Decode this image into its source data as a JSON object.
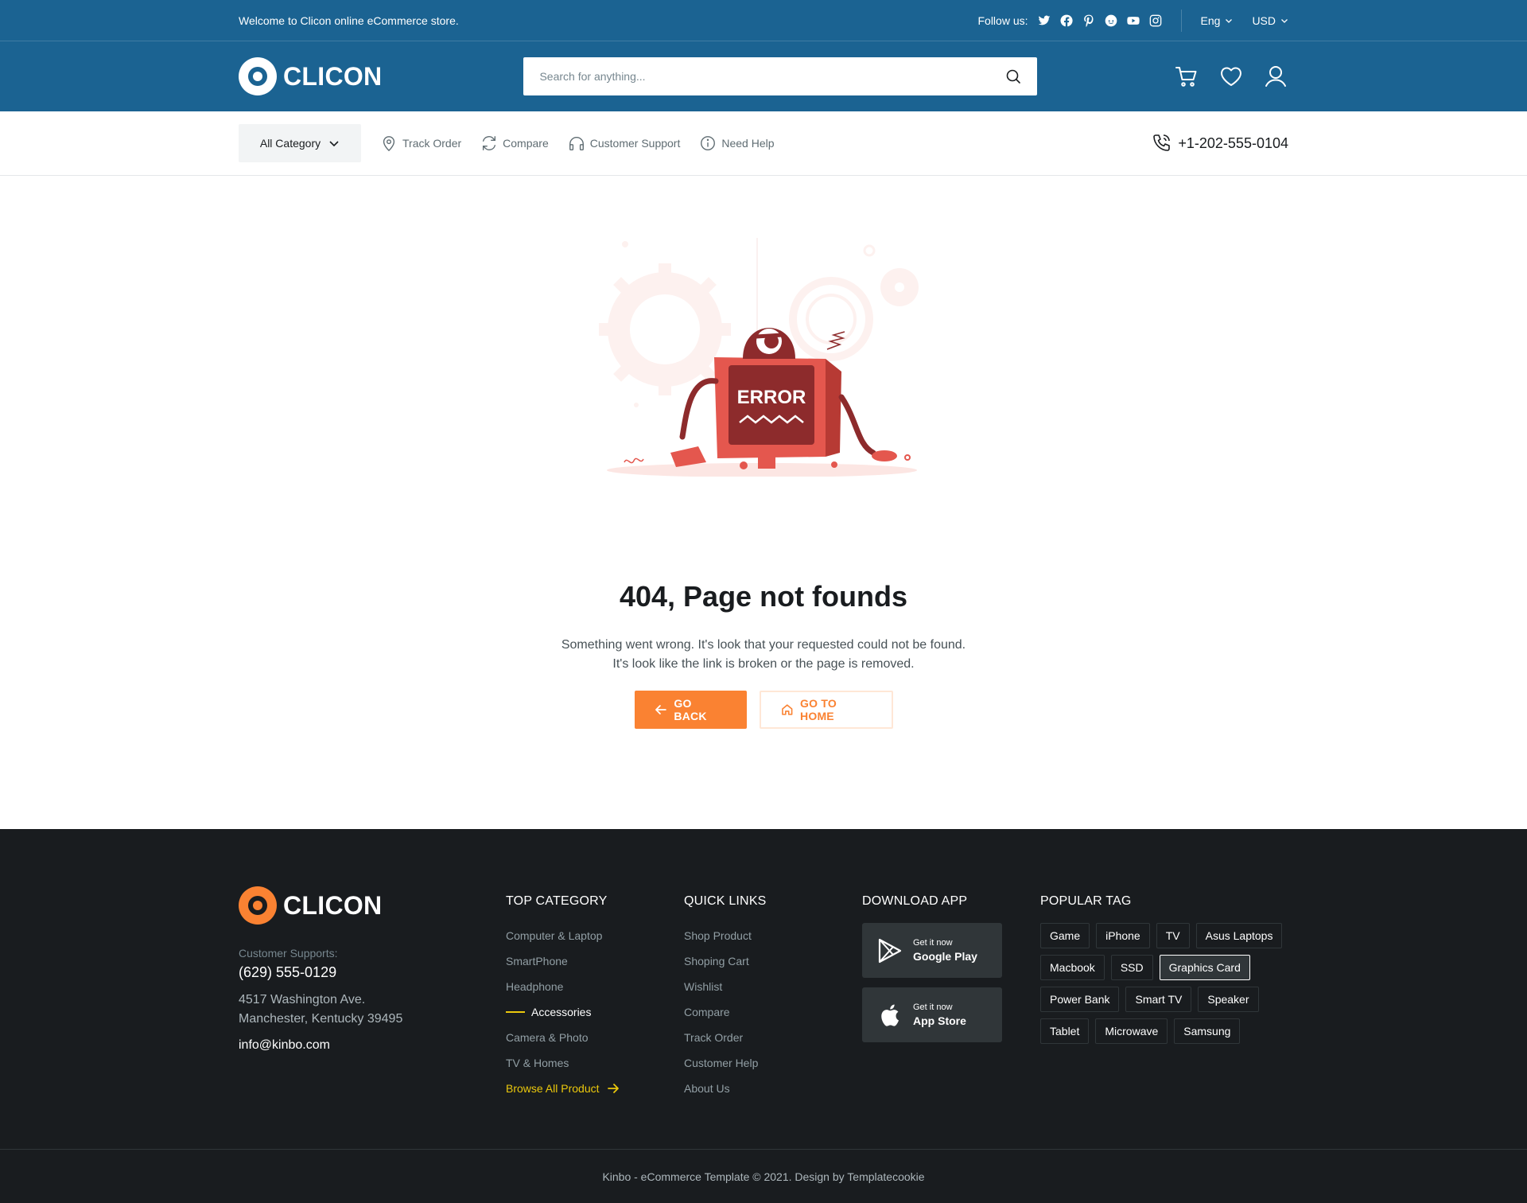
{
  "topbar": {
    "welcome": "Welcome to Clicon online eCommerce store.",
    "follow_label": "Follow us:",
    "social_icons": [
      "twitter-icon",
      "facebook-icon",
      "pinterest-icon",
      "reddit-icon",
      "youtube-icon",
      "instagram-icon"
    ],
    "language": "Eng",
    "currency": "USD"
  },
  "header": {
    "brand": "CLICON",
    "search_placeholder": "Search for anything...",
    "icons": [
      "cart-icon",
      "heart-icon",
      "user-icon"
    ]
  },
  "nav": {
    "all_category": "All Category",
    "links": [
      {
        "label": "Track Order",
        "icon": "map-pin-icon"
      },
      {
        "label": "Compare",
        "icon": "refresh-icon"
      },
      {
        "label": "Customer Support",
        "icon": "headphones-icon"
      },
      {
        "label": "Need Help",
        "icon": "info-icon"
      }
    ],
    "phone": "+1-202-555-0104"
  },
  "error": {
    "illustration_text": "ERROR",
    "title": "404, Page not founds",
    "desc_line1": "Something went wrong. It's look that your requested could not be found.",
    "desc_line2": "It's look like the link is broken or the page is removed.",
    "back_label": "GO BACK",
    "home_label": "GO TO HOME"
  },
  "footer": {
    "brand": "CLICON",
    "support_label": "Customer Supports:",
    "support_phone": "(629) 555-0129",
    "address_line1": "4517 Washington Ave.",
    "address_line2": "Manchester, Kentucky 39495",
    "email": "info@kinbo.com",
    "top_category": {
      "heading": "TOP CATEGORY",
      "items": [
        "Computer & Laptop",
        "SmartPhone",
        "Headphone",
        "Accessories",
        "Camera & Photo",
        "TV & Homes"
      ],
      "active_index": 3,
      "browse_all": "Browse All Product"
    },
    "quick_links": {
      "heading": "QUICK LINKS",
      "items": [
        "Shop Product",
        "Shoping Cart",
        "Wishlist",
        "Compare",
        "Track Order",
        "Customer Help",
        "About Us"
      ]
    },
    "download_app": {
      "heading": "DOWNLOAD APP",
      "google": {
        "small": "Get it now",
        "big": "Google Play"
      },
      "apple": {
        "small": "Get it now",
        "big": "App Store"
      }
    },
    "popular_tag": {
      "heading": "POPULAR TAG",
      "tags": [
        "Game",
        "iPhone",
        "TV",
        "Asus Laptops",
        "Macbook",
        "SSD",
        "Graphics Card",
        "Power Bank",
        "Smart TV",
        "Speaker",
        "Tablet",
        "Microwave",
        "Samsung"
      ],
      "active": "Graphics Card"
    },
    "copyright": "Kinbo - eCommerce Template © 2021. Design by Templatecookie"
  },
  "colors": {
    "primary_blue": "#1B6392",
    "accent_orange": "#FA8232",
    "footer_bg": "#191C1F",
    "highlight_yellow": "#EBC80C"
  }
}
